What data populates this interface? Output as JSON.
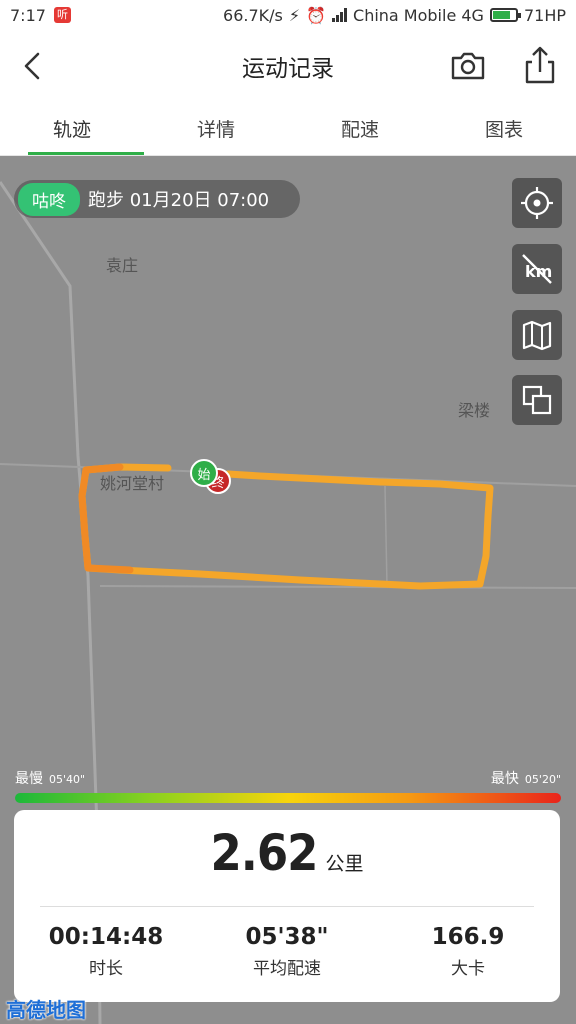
{
  "status_bar": {
    "time": "7:17",
    "notification_badge": "听",
    "speed": "66.7K/s",
    "carrier": "China Mobile 4G",
    "battery": "71HP"
  },
  "header": {
    "title": "运动记录"
  },
  "tabs": [
    {
      "label": "轨迹",
      "active": true
    },
    {
      "label": "详情",
      "active": false
    },
    {
      "label": "配速",
      "active": false
    },
    {
      "label": "图表",
      "active": false
    }
  ],
  "map": {
    "places": [
      "袁庄",
      "梁楼",
      "姚河堂村"
    ],
    "start_marker": "始",
    "end_marker": "终",
    "info_pill": {
      "tag": "咕咚",
      "text": "跑步  01月20日 07:00"
    },
    "side_buttons": [
      "locate-icon",
      "hide-km-icon",
      "map-icon",
      "layers-icon"
    ],
    "route_color": "#f5a623",
    "legend": {
      "slow_label": "最慢",
      "slow_value": "05'40\"",
      "fast_label": "最快",
      "fast_value": "05'20\""
    }
  },
  "summary": {
    "distance": "2.62",
    "distance_unit": "公里",
    "stats": [
      {
        "value": "00:14:48",
        "label": "时长"
      },
      {
        "value": "05'38\"",
        "label": "平均配速"
      },
      {
        "value": "166.9",
        "label": "大卡"
      }
    ]
  },
  "watermark": "高德地图",
  "colors": {
    "accent": "#2fae48",
    "tag_green": "#34c274",
    "map_bg": "#8e8e8e"
  }
}
